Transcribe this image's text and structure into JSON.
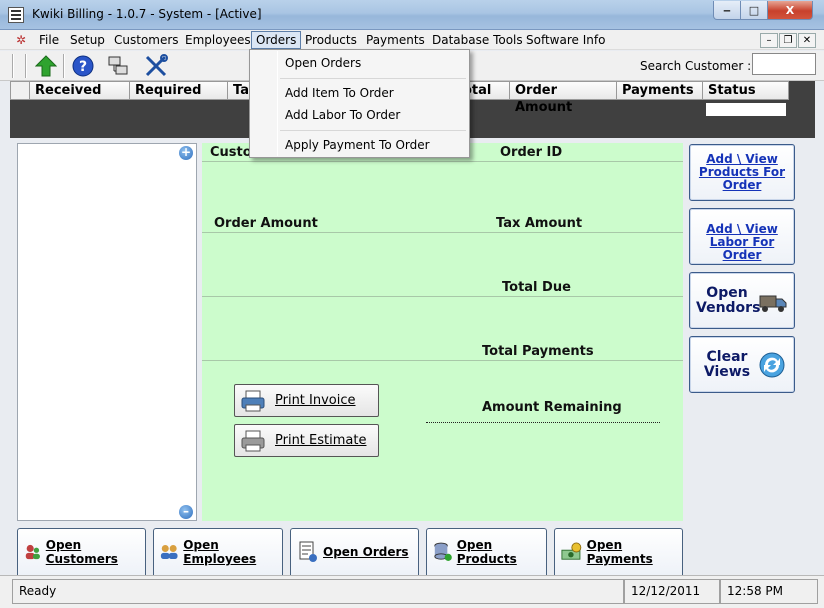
{
  "window": {
    "title": "Kwiki Billing - 1.0.7 - System - [Active]",
    "minimize_label": "‒",
    "maximize_label": "□",
    "close_label": "X"
  },
  "menu": {
    "items": [
      "File",
      "Setup",
      "Customers",
      "Employees",
      "Orders",
      "Products",
      "Payments",
      "Database Tools",
      "Software Info"
    ],
    "active": "Orders"
  },
  "orders_menu": {
    "items": [
      "Open Orders",
      "Add Item To Order",
      "Add Labor To Order",
      "Apply Payment To Order"
    ]
  },
  "toolbar": {
    "search_label": "Search Customer :",
    "search_value": "",
    "icons": [
      "green-up-arrow-icon",
      "help-icon",
      "network-icon",
      "tools-icon"
    ]
  },
  "grid": {
    "columns": [
      "Received",
      "Required",
      "Ta",
      "",
      "otal",
      "Order Amount",
      "Payments",
      "Status"
    ]
  },
  "detail": {
    "customer_label": "Custo",
    "order_id_label": "Order ID",
    "order_amount_label": "Order Amount",
    "tax_amount_label": "Tax Amount",
    "total_due_label": "Total Due",
    "total_payments_label": "Total Payments",
    "amount_remaining_label": "Amount Remaining",
    "print_invoice_label": "Print Invoice",
    "print_estimate_label": "Print Estimate"
  },
  "side_buttons": {
    "add_products_label": "Add \\ View Products For Order",
    "add_labor_label": "Add \\ View Labor For Order",
    "open_vendors_label": "Open Vendors",
    "clear_views_label": "Clear Views"
  },
  "nav_buttons": [
    "Open Customers",
    "Open Employees",
    "Open Orders",
    "Open Products",
    "Open Payments"
  ],
  "status": {
    "text": "Ready",
    "date": "12/12/2011",
    "time": "12:58 PM"
  }
}
